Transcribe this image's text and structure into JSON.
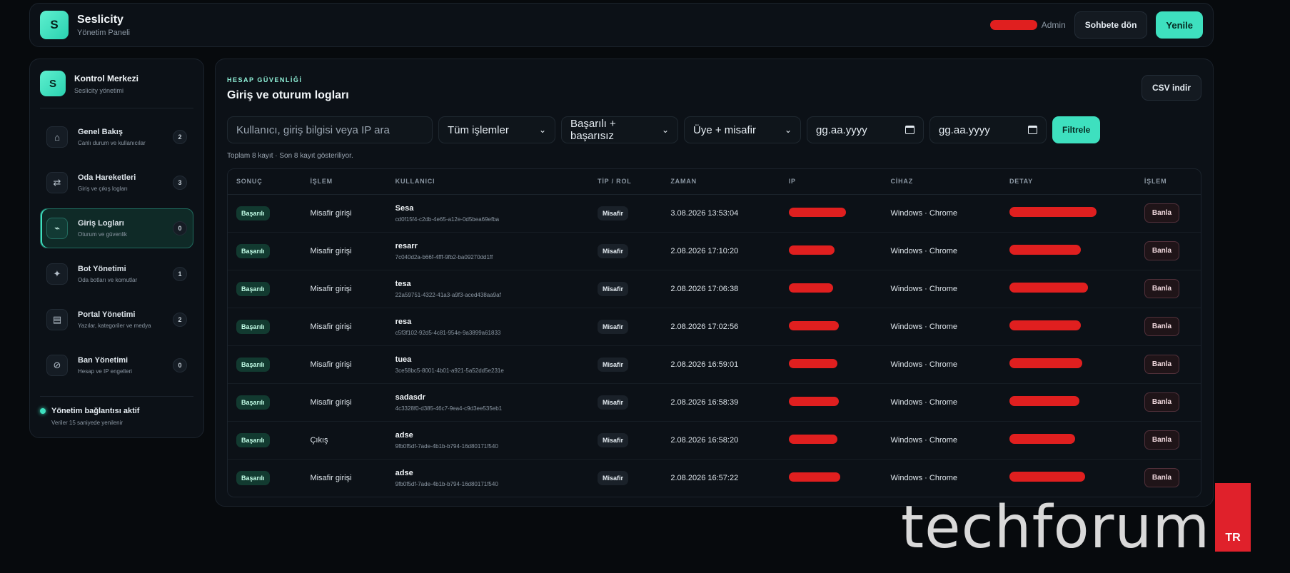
{
  "app": {
    "logo_letter": "S",
    "title": "Seslicity",
    "subtitle": "Yönetim Paneli"
  },
  "topbar": {
    "user_role": "Admin",
    "back_label": "Sohbete dön",
    "refresh_label": "Yenile"
  },
  "sidebar": {
    "logo_letter": "S",
    "title": "Kontrol Merkezi",
    "subtitle": "Seslicity yönetimi",
    "items": [
      {
        "icon": "⌂",
        "label": "Genel Bakış",
        "desc": "Canlı durum ve kullanıcılar",
        "count": "2"
      },
      {
        "icon": "⇄",
        "label": "Oda Hareketleri",
        "desc": "Giriş ve çıkış logları",
        "count": "3"
      },
      {
        "icon": "⌁",
        "label": "Giriş Logları",
        "desc": "Oturum ve güvenlik",
        "count": "0"
      },
      {
        "icon": "✦",
        "label": "Bot Yönetimi",
        "desc": "Oda botları ve komutlar",
        "count": "1"
      },
      {
        "icon": "▤",
        "label": "Portal Yönetimi",
        "desc": "Yazılar, kategoriler ve medya",
        "count": "2"
      },
      {
        "icon": "⊘",
        "label": "Ban Yönetimi",
        "desc": "Hesap ve IP engelleri",
        "count": "0"
      }
    ],
    "status_title": "Yönetim bağlantısı aktif",
    "status_desc": "Veriler 15 saniyede yenilenir"
  },
  "main": {
    "eyebrow": "HESAP GÜVENLİĞİ",
    "title": "Giriş ve oturum logları",
    "csv_label": "CSV indir",
    "search_placeholder": "Kullanıcı, giriş bilgisi veya IP ara",
    "select_action": "Tüm işlemler",
    "select_result": "Başarılı + başarısız",
    "select_role": "Üye + misafir",
    "date_from": "gg.aa.yyyy",
    "date_to": "gg.aa.yyyy",
    "filter_label": "Filtrele",
    "count_text": "Toplam 8 kayıt · Son 8 kayıt gösteriliyor."
  },
  "table": {
    "headers": [
      "SONUÇ",
      "İŞLEM",
      "KULLANICI",
      "TİP / ROL",
      "ZAMAN",
      "IP",
      "CİHAZ",
      "DETAY",
      "İŞLEM"
    ],
    "rows": [
      {
        "status": "Başarılı",
        "action": "Misafir girişi",
        "user": "Sesa",
        "uid": "cd0f15f4-c2db-4e65-a12e-0d5bea69efba",
        "role": "Misafir",
        "time": "3.08.2026 13:53:04",
        "device": "Windows · Chrome",
        "ban": "Banla"
      },
      {
        "status": "Başarılı",
        "action": "Misafir girişi",
        "user": "resarr",
        "uid": "7c040d2a-b66f-4fff-9fb2-ba09270dd1ff",
        "role": "Misafir",
        "time": "2.08.2026 17:10:20",
        "device": "Windows · Chrome",
        "ban": "Banla"
      },
      {
        "status": "Başarılı",
        "action": "Misafir girişi",
        "user": "tesa",
        "uid": "22a59751-4322-41a3-a9f3-aced438aa9af",
        "role": "Misafir",
        "time": "2.08.2026 17:06:38",
        "device": "Windows · Chrome",
        "ban": "Banla"
      },
      {
        "status": "Başarılı",
        "action": "Misafir girişi",
        "user": "resa",
        "uid": "c5f3f102-92d5-4c81-954e-9a3899a61833",
        "role": "Misafir",
        "time": "2.08.2026 17:02:56",
        "device": "Windows · Chrome",
        "ban": "Banla"
      },
      {
        "status": "Başarılı",
        "action": "Misafir girişi",
        "user": "tuea",
        "uid": "3ce58bc5-8001-4b01-a921-5a52dd5e231e",
        "role": "Misafir",
        "time": "2.08.2026 16:59:01",
        "device": "Windows · Chrome",
        "ban": "Banla"
      },
      {
        "status": "Başarılı",
        "action": "Misafir girişi",
        "user": "sadasdr",
        "uid": "4c3328f0-d385-46c7-9ea4-c9d3ee535eb1",
        "role": "Misafir",
        "time": "2.08.2026 16:58:39",
        "device": "Windows · Chrome",
        "ban": "Banla"
      },
      {
        "status": "Başarılı",
        "action": "Çıkış",
        "user": "adse",
        "uid": "9fb0f5df-7ade-4b1b-b794-16d80171f540",
        "role": "Misafir",
        "time": "2.08.2026 16:58:20",
        "device": "Windows · Chrome",
        "ban": "Banla"
      },
      {
        "status": "Başarılı",
        "action": "Misafir girişi",
        "user": "adse",
        "uid": "9fb0f5df-7ade-4b1b-b794-16d80171f540",
        "role": "Misafir",
        "time": "2.08.2026 16:57:22",
        "device": "Windows · Chrome",
        "ban": "Banla"
      }
    ]
  },
  "watermark": {
    "text": "techforum",
    "country": "TR"
  },
  "colors": {
    "accent": "#3ee0bf",
    "redaction": "#e01f1f",
    "background": "#070a0d"
  }
}
